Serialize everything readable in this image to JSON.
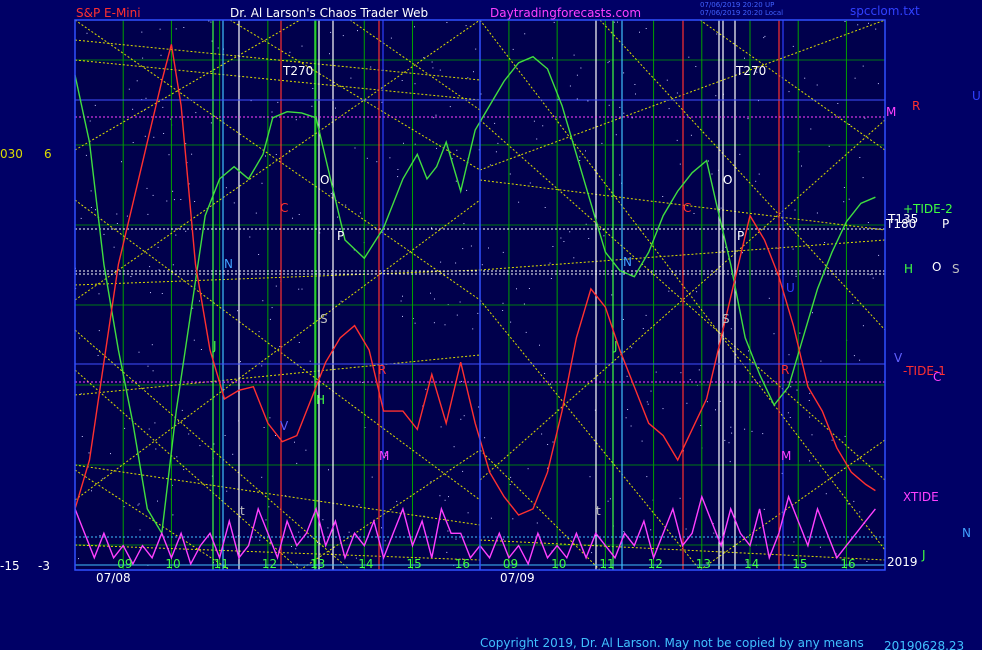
{
  "header": {
    "symbol": "S&P E-Mini",
    "site": "Dr. Al Larson's Chaos Trader Web",
    "url": "Daytradingforecasts.com",
    "stamp1": "07/06/2019 20:20 UP",
    "stamp2": "07/06/2019 20:20 Local",
    "file": "spcclom.txt"
  },
  "footer": {
    "copyright": "Copyright 2019, Dr. Al Larson. May not be copied by any means",
    "version": "20190628.23"
  },
  "axis": {
    "left_top": "030",
    "left_top2": "6",
    "left_bottom": "-15",
    "left_bottom2": "-3",
    "year": "2019",
    "dates": [
      "07/08",
      "07/09"
    ],
    "hours": [
      {
        "label": "09",
        "x": 9
      },
      {
        "label": "10",
        "x": 10
      },
      {
        "label": "11",
        "x": 11
      },
      {
        "label": "12",
        "x": 12
      },
      {
        "label": "13",
        "x": 13
      },
      {
        "label": "14",
        "x": 14
      },
      {
        "label": "15",
        "x": 15
      },
      {
        "label": "16",
        "x": 16
      },
      {
        "label": "09",
        "x": 17
      },
      {
        "label": "10",
        "x": 18
      },
      {
        "label": "11",
        "x": 19
      },
      {
        "label": "12",
        "x": 20
      },
      {
        "label": "13",
        "x": 21
      },
      {
        "label": "14",
        "x": 22
      },
      {
        "label": "15",
        "x": 23
      },
      {
        "label": "16",
        "x": 24
      }
    ]
  },
  "legend_right": {
    "tide2": "+TIDE-2",
    "t135": "T135",
    "t180": "T180",
    "tide1": "-TIDE-1",
    "xtide": "XTIDE",
    "letters": [
      {
        "text": "M",
        "color": "#ff40ff"
      },
      {
        "text": "R",
        "color": "#ff3030"
      },
      {
        "text": "U",
        "color": "#3040ff"
      },
      {
        "text": "P",
        "color": "#ffffff"
      },
      {
        "text": "H",
        "color": "#40ff40"
      },
      {
        "text": "O",
        "color": "#ffffff"
      },
      {
        "text": "S",
        "color": "#c0c0c0"
      },
      {
        "text": "V",
        "color": "#6060ff"
      },
      {
        "text": "C",
        "color": "#ff40ff"
      },
      {
        "text": "N",
        "color": "#40a0ff"
      },
      {
        "text": "J",
        "color": "#40ff40"
      }
    ]
  },
  "annotations": [
    {
      "text": "T270",
      "color": "#ffffff"
    },
    {
      "text": "T270",
      "color": "#ffffff"
    },
    {
      "text": "O",
      "color": "#ffffff"
    },
    {
      "text": "O",
      "color": "#ffffff"
    },
    {
      "text": "P",
      "color": "#ffffff"
    },
    {
      "text": "P",
      "color": "#ffffff"
    },
    {
      "text": "S",
      "color": "#c0c0c0"
    },
    {
      "text": "S",
      "color": "#c0c0c0"
    },
    {
      "text": "N",
      "color": "#40a0ff"
    },
    {
      "text": "N",
      "color": "#40a0ff"
    },
    {
      "text": "J",
      "color": "#40ff40"
    },
    {
      "text": "J",
      "color": "#40ff40"
    },
    {
      "text": "H",
      "color": "#40ff40"
    },
    {
      "text": "C",
      "color": "#ff3030"
    },
    {
      "text": "C",
      "color": "#ff3030"
    },
    {
      "text": "R",
      "color": "#ff3030"
    },
    {
      "text": "R",
      "color": "#ff3030"
    },
    {
      "text": "M",
      "color": "#ff40ff"
    },
    {
      "text": "M",
      "color": "#ff40ff"
    },
    {
      "text": "U",
      "color": "#3040ff"
    },
    {
      "text": "V",
      "color": "#6060ff"
    },
    {
      "text": "t",
      "color": "#c0c0c0"
    },
    {
      "text": "t",
      "color": "#c0c0c0"
    }
  ],
  "chart_data": {
    "type": "line",
    "xlim": [
      8,
      24.8
    ],
    "ylim": [
      -15,
      30
    ],
    "series": [
      {
        "name": "+TIDE-2",
        "color": "#40dd40",
        "x": [
          8.0,
          8.3,
          8.6,
          8.9,
          9.2,
          9.5,
          9.8,
          10.1,
          10.4,
          10.7,
          11.0,
          11.3,
          11.6,
          11.9,
          12.1,
          12.4,
          12.7,
          13.0,
          13.3,
          13.6,
          14.0,
          14.4,
          14.8,
          15.1,
          15.3,
          15.5,
          15.7,
          16.0,
          16.3,
          16.6,
          16.9,
          17.2,
          17.5,
          17.8,
          18.1,
          18.4,
          18.7,
          19.0,
          19.3,
          19.6,
          19.9,
          20.2,
          20.5,
          20.8,
          21.1,
          21.3,
          21.6,
          21.9,
          22.2,
          22.5,
          22.8,
          23.1,
          23.4,
          23.7,
          24.0,
          24.3,
          24.6
        ],
        "y": [
          25.5,
          20,
          10,
          3,
          -3,
          -10,
          -12,
          -2,
          6,
          14,
          17,
          18,
          17,
          19,
          22,
          22.5,
          22.4,
          22,
          17,
          12,
          10.5,
          13,
          17,
          19,
          17,
          18,
          20,
          16,
          21,
          23,
          25,
          26.5,
          27,
          26,
          23,
          19,
          15,
          11,
          9.5,
          9,
          11,
          14,
          16,
          17.5,
          18.5,
          15,
          10,
          4,
          1,
          -1.5,
          0,
          4,
          8,
          11,
          13.5,
          15,
          15.5
        ]
      },
      {
        "name": "-TIDE-1",
        "color": "#ff3030",
        "x": [
          8.0,
          8.3,
          8.6,
          8.9,
          9.2,
          9.5,
          9.8,
          10.0,
          10.2,
          10.5,
          10.8,
          11.1,
          11.4,
          11.7,
          12.0,
          12.3,
          12.6,
          12.9,
          13.2,
          13.5,
          13.8,
          14.1,
          14.4,
          14.8,
          15.1,
          15.4,
          15.7,
          16.0,
          16.3,
          16.6,
          16.9,
          17.2,
          17.5,
          17.8,
          18.1,
          18.4,
          18.7,
          19.0,
          19.3,
          19.6,
          19.9,
          20.2,
          20.5,
          20.8,
          21.1,
          21.4,
          21.7,
          22.0,
          22.3,
          22.6,
          22.9,
          23.2,
          23.5,
          23.8,
          24.1,
          24.4,
          24.6
        ],
        "y": [
          -10,
          -6,
          2,
          10,
          15,
          20,
          25,
          28,
          23,
          10,
          3,
          -1,
          -0.3,
          0,
          -3,
          -4.5,
          -4,
          -1,
          2,
          4,
          5,
          3,
          -2,
          -2,
          -3.5,
          1,
          -3,
          2,
          -3,
          -7,
          -9,
          -10.5,
          -10,
          -7,
          -2,
          4,
          8,
          6.5,
          3,
          0,
          -3,
          -4,
          -6,
          -3.5,
          -1,
          4,
          9,
          14,
          12,
          9,
          5,
          0,
          -2,
          -5,
          -7,
          -8,
          -8.5
        ]
      },
      {
        "name": "XTIDE",
        "color": "#ff40ff",
        "x": [
          8.0,
          8.2,
          8.4,
          8.6,
          8.8,
          9.0,
          9.2,
          9.4,
          9.6,
          9.8,
          10.0,
          10.2,
          10.4,
          10.6,
          10.8,
          11.0,
          11.2,
          11.4,
          11.6,
          11.8,
          12.0,
          12.2,
          12.4,
          12.6,
          12.8,
          13.0,
          13.2,
          13.4,
          13.6,
          13.8,
          14.0,
          14.2,
          14.4,
          14.6,
          14.8,
          15.0,
          15.2,
          15.4,
          15.6,
          15.8,
          16.0,
          16.2,
          16.4,
          16.6,
          16.8,
          17.0,
          17.2,
          17.4,
          17.6,
          17.8,
          18.0,
          18.2,
          18.4,
          18.6,
          18.8,
          19.0,
          19.2,
          19.4,
          19.6,
          19.8,
          20.0,
          20.2,
          20.4,
          20.6,
          20.8,
          21.0,
          21.2,
          21.4,
          21.6,
          21.8,
          22.0,
          22.2,
          22.4,
          22.6,
          22.8,
          23.0,
          23.2,
          23.4,
          23.6,
          23.8,
          24.0,
          24.2,
          24.4,
          24.6
        ],
        "y": [
          -10,
          -12,
          -14,
          -12,
          -14,
          -13,
          -14.5,
          -13,
          -14,
          -12,
          -14,
          -12,
          -14.5,
          -13,
          -12,
          -14,
          -11,
          -14,
          -13,
          -10,
          -12,
          -14,
          -11,
          -13,
          -12,
          -10,
          -13,
          -11,
          -14,
          -12,
          -13,
          -11,
          -14,
          -12,
          -10,
          -13,
          -11,
          -14,
          -10,
          -12,
          -12,
          -14,
          -13,
          -14,
          -12,
          -14,
          -13,
          -14.5,
          -12,
          -14,
          -13,
          -14,
          -12,
          -14,
          -12,
          -13,
          -14,
          -12,
          -13,
          -11,
          -14,
          -12,
          -10,
          -13,
          -12,
          -9,
          -11,
          -13,
          -10,
          -12,
          -13,
          -10,
          -14,
          -12,
          -9,
          -11,
          -13,
          -10,
          -12,
          -14,
          -13,
          -12,
          -11,
          -10
        ]
      }
    ],
    "colors": {
      "grid": "#00a000",
      "frame": "#3050ff",
      "trend": "#dddd00",
      "hline_blue": "#4050ff",
      "hline_pink": "#ff40ff",
      "hline_white": "#ffffff"
    }
  }
}
